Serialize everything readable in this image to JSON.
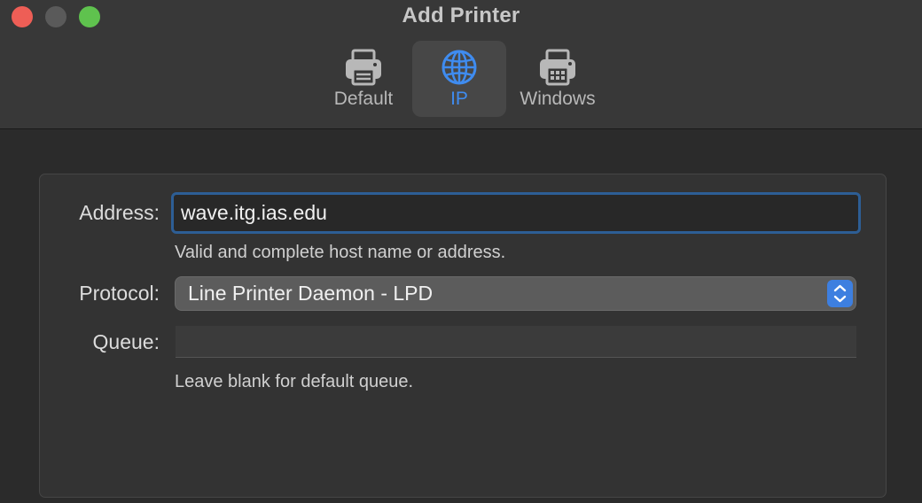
{
  "window": {
    "title": "Add Printer"
  },
  "toolbar": {
    "tabs": [
      {
        "label": "Default",
        "icon": "printer-icon",
        "selected": false
      },
      {
        "label": "IP",
        "icon": "globe-icon",
        "selected": true
      },
      {
        "label": "Windows",
        "icon": "windows-printer-icon",
        "selected": false
      }
    ]
  },
  "form": {
    "address": {
      "label": "Address:",
      "value": "wave.itg.ias.edu",
      "hint": "Valid and complete host name or address."
    },
    "protocol": {
      "label": "Protocol:",
      "value": "Line Printer Daemon - LPD"
    },
    "queue": {
      "label": "Queue:",
      "value": "",
      "hint": "Leave blank for default queue."
    }
  },
  "colors": {
    "accent": "#3f8cf0",
    "close": "#ee5e56",
    "minimize": "#5a5a5a",
    "maximize": "#5fc24e"
  }
}
